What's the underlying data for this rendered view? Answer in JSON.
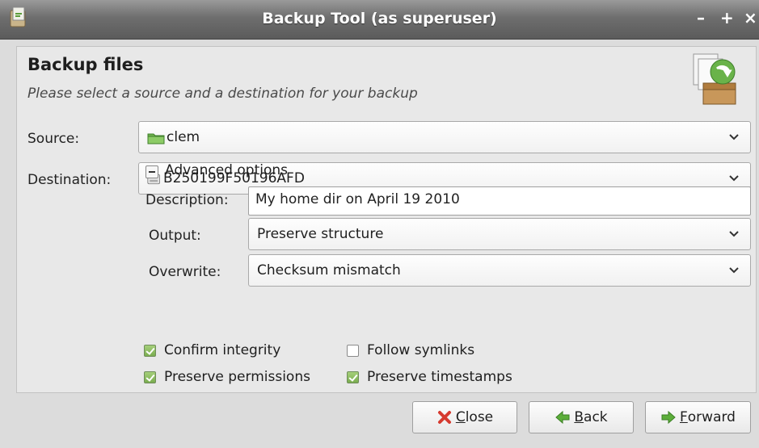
{
  "window": {
    "title": "Backup Tool (as superuser)",
    "controls": {
      "minimize": "–",
      "maximize": "+",
      "close": "×"
    }
  },
  "header": {
    "title": "Backup files",
    "subtitle": "Please select a source and a destination for your backup",
    "icon": "backup-box-icon"
  },
  "form": {
    "source": {
      "label": "Source:",
      "value": "clem",
      "icon": "folder-icon"
    },
    "destination": {
      "label": "Destination:",
      "value": "B250199F50196AFD",
      "icon": "drive-icon"
    },
    "advanced": {
      "label": "Advanced options",
      "expanded": true
    },
    "description": {
      "label": "Description:",
      "value": "My home dir on April 19 2010"
    },
    "output": {
      "label": "Output:",
      "value": "Preserve structure"
    },
    "overwrite": {
      "label": "Overwrite:",
      "value": "Checksum mismatch"
    },
    "options": [
      {
        "label": "Confirm integrity",
        "checked": true
      },
      {
        "label": "Follow symlinks",
        "checked": false
      },
      {
        "label": "Preserve permissions",
        "checked": true
      },
      {
        "label": "Preserve timestamps",
        "checked": true
      }
    ]
  },
  "buttons": {
    "close": {
      "mnemonic": "C",
      "rest": "lose",
      "icon": "red-x-icon"
    },
    "back": {
      "mnemonic": "B",
      "rest": "ack",
      "icon": "green-left-arrow-icon"
    },
    "forward": {
      "mnemonic": "F",
      "rest": "orward",
      "icon": "green-right-arrow-icon"
    }
  },
  "colors": {
    "titlebar": "#6e6e6e",
    "checkbox_on": "#7aad4f",
    "arrow_green": "#5cae3a",
    "close_red": "#d63a2f"
  }
}
